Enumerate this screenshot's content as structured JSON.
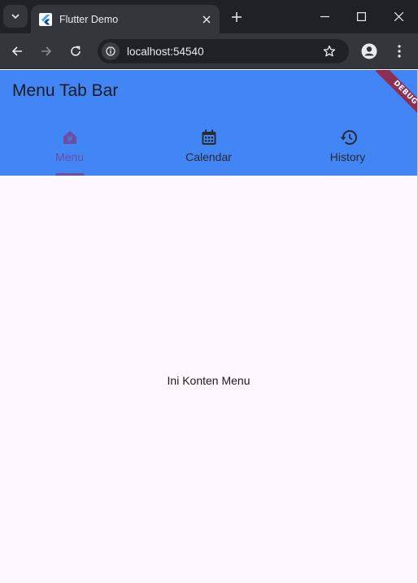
{
  "browser": {
    "tab": {
      "title": "Flutter Demo"
    },
    "address_bar": {
      "url": "localhost:54540"
    },
    "icons": [
      "tab-search-icon",
      "flutter-favicon",
      "close-icon",
      "plus-icon",
      "minimize-icon",
      "maximize-icon",
      "window-close-icon",
      "back-arrow-icon",
      "forward-arrow-icon",
      "reload-icon",
      "site-info-icon",
      "star-icon",
      "profile-icon",
      "kebab-menu-icon"
    ]
  },
  "app": {
    "title": "Menu Tab Bar",
    "debug_banner": "DEBUG",
    "tabs": [
      {
        "label": "Menu",
        "icon": "restaurant-menu-icon",
        "active": true
      },
      {
        "label": "Calendar",
        "icon": "calendar-icon",
        "active": false
      },
      {
        "label": "History",
        "icon": "history-icon",
        "active": false
      }
    ],
    "content_text": "Ini Konten Menu"
  },
  "colors": {
    "appbar": "#4285f4",
    "active_tab": "#6b4fa0",
    "body_background": "#fdf7ff",
    "debug_banner": "#8d2f55"
  }
}
